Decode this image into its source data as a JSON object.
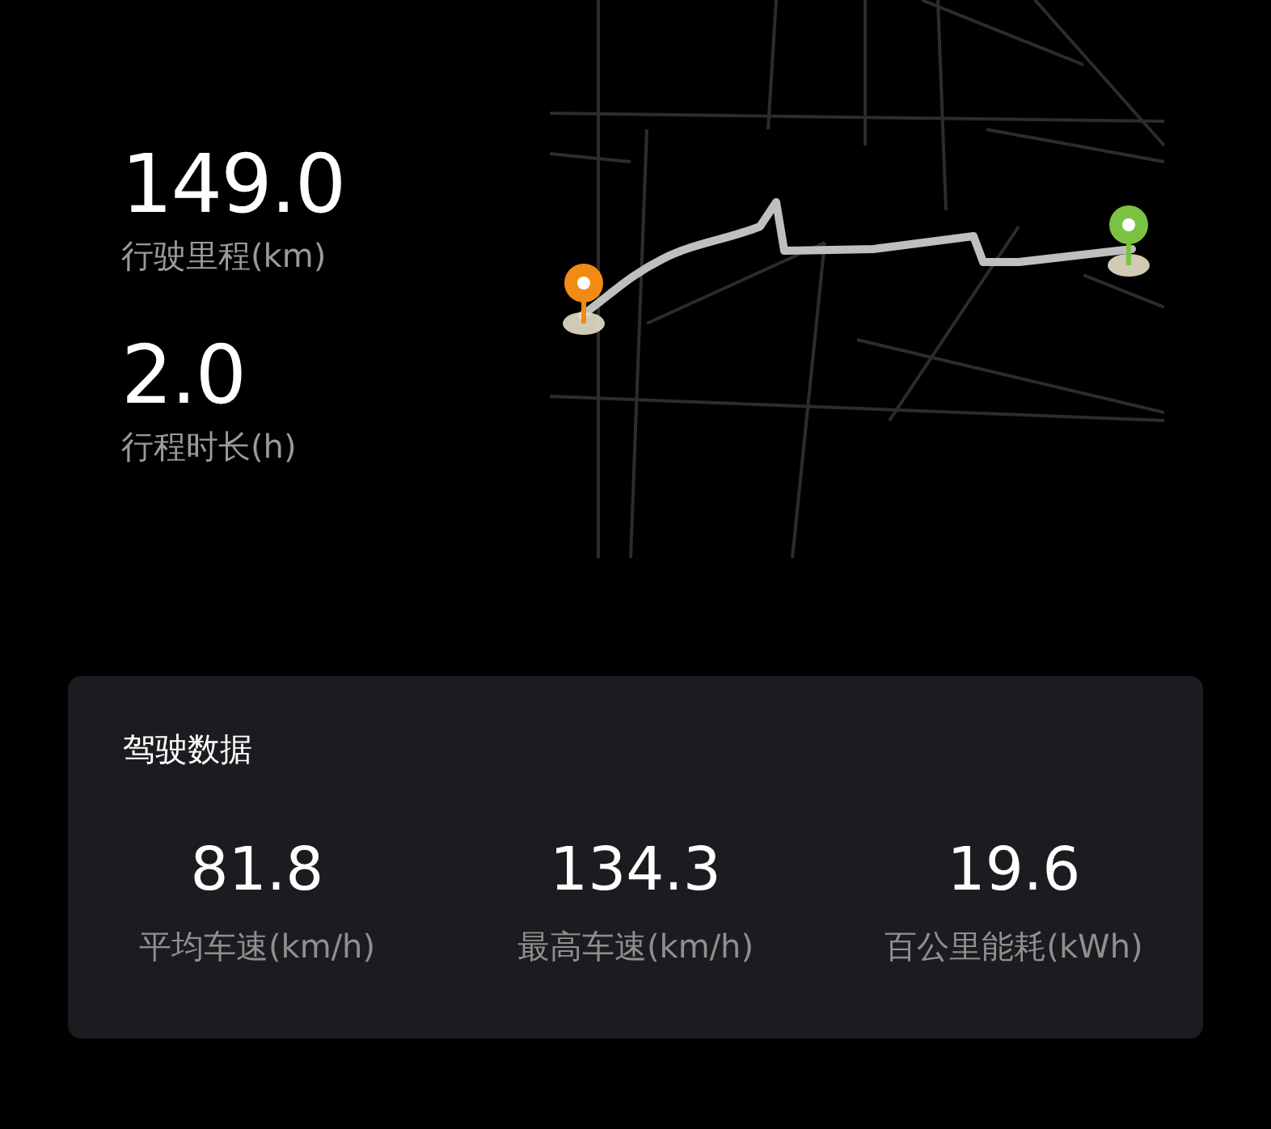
{
  "trip": [
    {
      "value": "149.0",
      "label": "行驶里程(km)"
    },
    {
      "value": "2.0",
      "label": "行程时长(h)"
    }
  ],
  "driving_data": {
    "title": "驾驶数据",
    "stats": [
      {
        "value": "81.8",
        "label": "平均车速(km/h)"
      },
      {
        "value": "134.3",
        "label": "最高车速(km/h)"
      },
      {
        "value": "19.6",
        "label": "百公里能耗(kWh)"
      }
    ]
  }
}
